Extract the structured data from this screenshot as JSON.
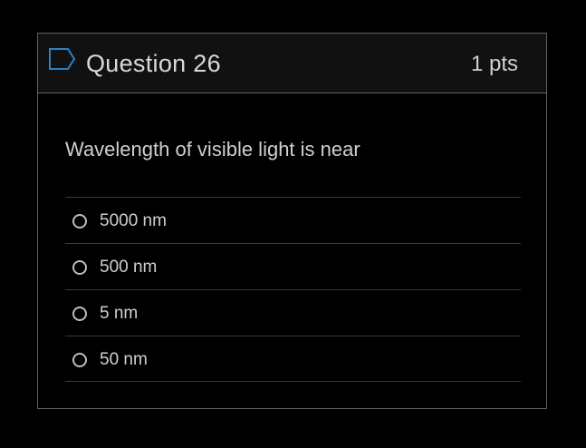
{
  "question": {
    "title": "Question 26",
    "points": "1 pts",
    "text": "Wavelength of visible light is near",
    "flag_icon": "bookmark-flag-icon",
    "answers": [
      {
        "label": "5000 nm",
        "selected": false
      },
      {
        "label": "500 nm",
        "selected": false
      },
      {
        "label": "5 nm",
        "selected": false
      },
      {
        "label": "50 nm",
        "selected": false
      }
    ]
  },
  "colors": {
    "background": "#000000",
    "header_background": "#111111",
    "border": "#5f5f5f",
    "flag_icon": "#2f7fbf",
    "text": "#cfcfcf"
  }
}
